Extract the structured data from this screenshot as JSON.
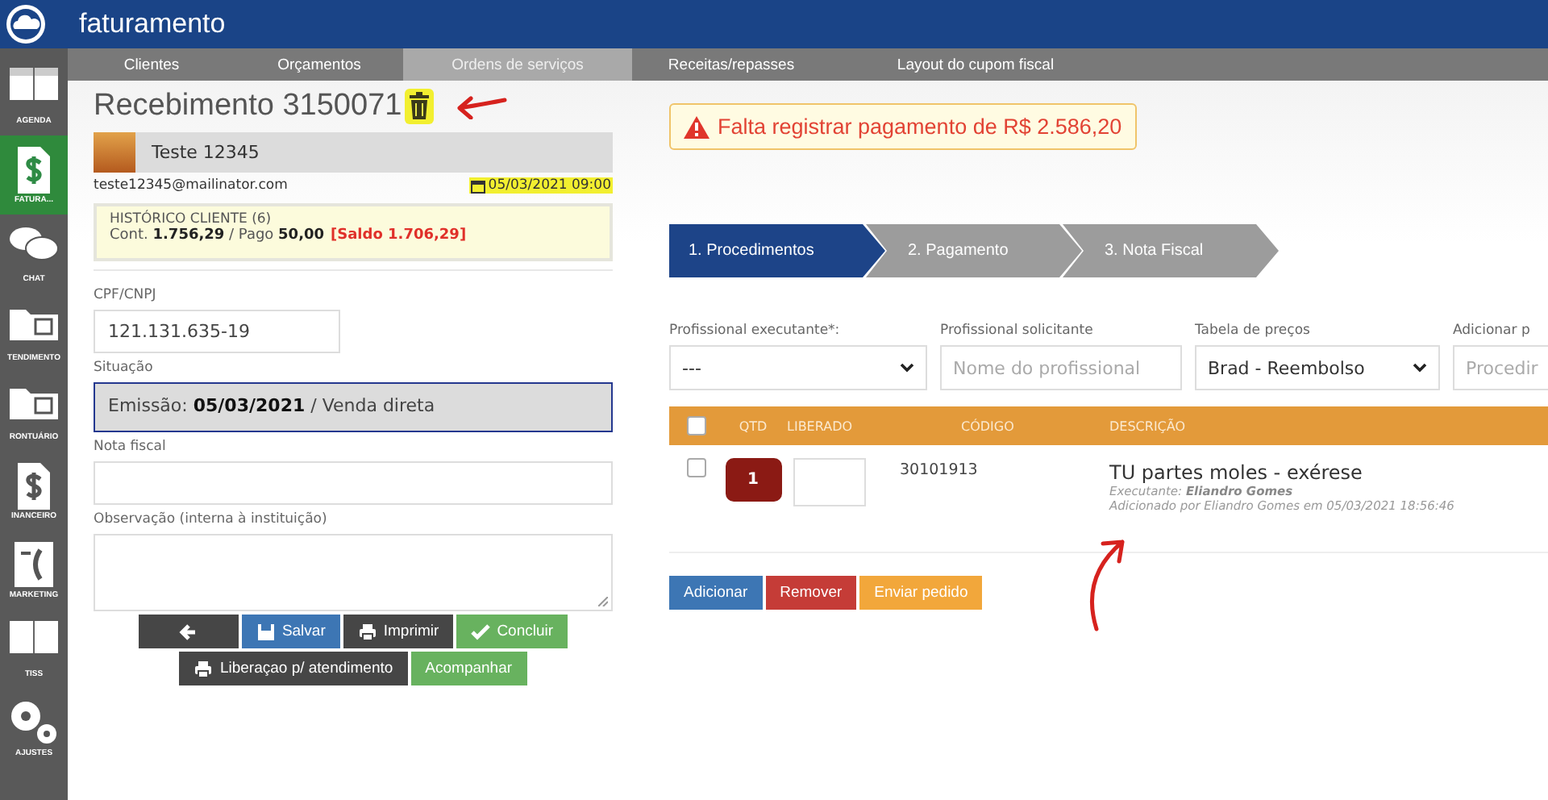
{
  "app": {
    "title": "faturamento"
  },
  "sidebar": {
    "items": [
      {
        "label": "AGENDA",
        "selected": false
      },
      {
        "label": "FATURA...",
        "selected": true
      },
      {
        "label": "CHAT",
        "selected": false
      },
      {
        "label": "TENDIMENTO",
        "selected": false
      },
      {
        "label": "RONTUÁRIO",
        "selected": false
      },
      {
        "label": "INANCEIRO",
        "selected": false
      },
      {
        "label": "MARKETING",
        "selected": false
      },
      {
        "label": "TISS",
        "selected": false
      },
      {
        "label": "AJUSTES",
        "selected": false
      }
    ]
  },
  "tabs": [
    {
      "label": "Clientes",
      "selected": false
    },
    {
      "label": "Orçamentos",
      "selected": false
    },
    {
      "label": "Ordens de serviços",
      "selected": true
    },
    {
      "label": "Receitas/repasses",
      "selected": false
    },
    {
      "label": "Layout do cupom fiscal",
      "selected": false
    }
  ],
  "receipt": {
    "title": "Recebimento 3150071",
    "client_name": "Teste 12345",
    "email": "teste12345@mailinator.com",
    "date": "05/03/2021 09:00"
  },
  "history": {
    "title": "HISTÓRICO CLIENTE (6)",
    "summary": "Cont. **1.756,29** / Pago **50,00**",
    "balance": "[Saldo 1.706,29]"
  },
  "form": {
    "fields": [
      {
        "label": "CPF/CNPJ",
        "value": "121.131.635-19",
        "kind": "short"
      },
      {
        "label": "Situação",
        "value": "Emissão: **05/03/2021** / Venda direta",
        "kind": "readonly"
      },
      {
        "label": "Nota fiscal",
        "kind": "text"
      },
      {
        "label": "Observação (interna à instituição)",
        "kind": "textarea"
      }
    ]
  },
  "form_buttons": [
    [
      {
        "kind": "dark"
      },
      {
        "label": "Salvar",
        "kind": "primary"
      },
      {
        "label": "Imprimir",
        "kind": "dark"
      },
      {
        "label": "Concluir",
        "kind": "success"
      }
    ],
    [
      {
        "label": "Liberaçao p/ atendimento",
        "kind": "dark"
      },
      {
        "label": "Acompanhar",
        "kind": "success"
      }
    ]
  ],
  "alert": "Falta registrar pagamento de R$ 2.586,20",
  "steps": [
    {
      "label": "1. Procedimentos",
      "selected": true
    },
    {
      "label": "2. Pagamento",
      "selected": false
    },
    {
      "label": "3. Nota Fiscal",
      "selected": false
    }
  ],
  "filters": [
    {
      "label": "Profissional executante*:",
      "value": "---",
      "kind": "select"
    },
    {
      "label": "Profissional solicitante",
      "placeholder": "Nome do profissional",
      "kind": "input"
    },
    {
      "label": "Tabela de preços",
      "value": "Brad - Reembolso",
      "kind": "select"
    },
    {
      "label": "Adicionar p",
      "placeholder": "Procedir",
      "kind": "input"
    }
  ],
  "table": {
    "columns": [
      "QTD",
      "LIBERADO",
      "CÓDIGO",
      "DESCRIÇÃO"
    ],
    "header_checked": false,
    "rows": [
      {
        "checked": false,
        "qtd": "1",
        "code": "30101913",
        "description": "TU partes moles - exérese",
        "executor": "Executante: **Eliandro Gomes**",
        "added": "Adicionado por Eliandro Gomes em 05/03/2021 18:56:46"
      }
    ]
  },
  "actions": [
    {
      "label": "Adicionar",
      "kind": "primary"
    },
    {
      "label": "Remover",
      "kind": "danger"
    },
    {
      "label": "Enviar pedido",
      "kind": "warning"
    }
  ]
}
